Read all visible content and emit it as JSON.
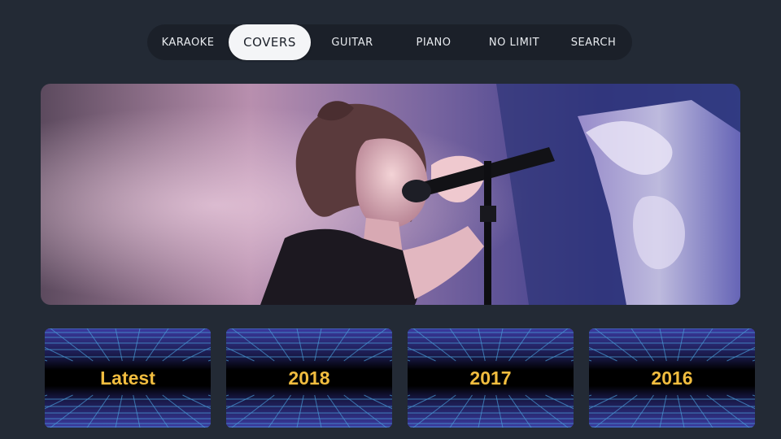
{
  "nav": {
    "tabs": [
      {
        "label": "KARAOKE",
        "active": false
      },
      {
        "label": "COVERS",
        "active": true
      },
      {
        "label": "GUITAR",
        "active": false
      },
      {
        "label": "PIANO",
        "active": false
      },
      {
        "label": "NO LIMIT",
        "active": false
      },
      {
        "label": "SEARCH",
        "active": false
      }
    ]
  },
  "hero": {
    "subject": "singer-performing-on-stage"
  },
  "cards": [
    {
      "label": "Latest"
    },
    {
      "label": "2018"
    },
    {
      "label": "2017"
    },
    {
      "label": "2016"
    }
  ],
  "colors": {
    "background": "#232a35",
    "nav_background": "#1b2029",
    "active_tab": "#f4f5f7",
    "card_label": "#f1bd3f",
    "grid_line": "#4a9dd8"
  }
}
